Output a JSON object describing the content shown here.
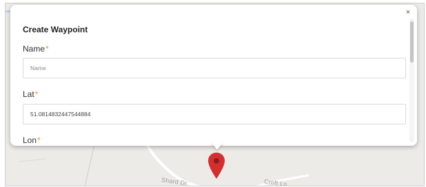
{
  "popup": {
    "title": "Create Waypoint",
    "close_label": "×",
    "fields": {
      "name": {
        "label": "Name",
        "placeholder": "Name",
        "value": ""
      },
      "lat": {
        "label": "Lat",
        "value": "51.0814832447544884"
      },
      "lon": {
        "label": "Lon"
      }
    },
    "required_mark": "*"
  },
  "map": {
    "street_labels": [
      "Shard Dr",
      "Croft Ln"
    ]
  },
  "colors": {
    "required_asterisk": "#e8962e",
    "marker": "#d32f2f",
    "map_background": "#ecebe7"
  },
  "icons": {
    "marker": "map-pin-icon",
    "close": "close-icon"
  }
}
